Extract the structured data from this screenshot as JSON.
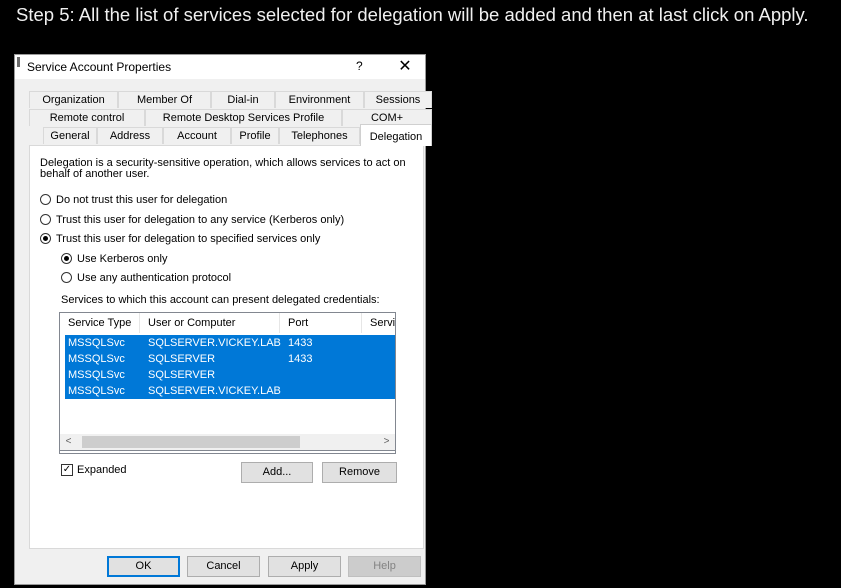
{
  "caption": "Step 5: All the list of services selected for delegation will be added and then at last click on Apply.",
  "dialog": {
    "title": "Service Account Properties",
    "help_label": "?",
    "close_label": "✕",
    "tabs_row1": [
      "Organization",
      "Member Of",
      "Dial-in",
      "Environment",
      "Sessions"
    ],
    "tabs_row2": [
      "Remote control",
      "Remote Desktop Services Profile",
      "COM+"
    ],
    "tabs_row3": [
      "General",
      "Address",
      "Account",
      "Profile",
      "Telephones",
      "Delegation"
    ],
    "active_tab": "Delegation",
    "description": "Delegation is a security-sensitive operation, which allows services to act on behalf of another user.",
    "trust_options": [
      {
        "label": "Do not trust this user for delegation",
        "selected": false
      },
      {
        "label": "Trust this user for delegation to any service (Kerberos only)",
        "selected": false
      },
      {
        "label": "Trust this user for delegation to specified services only",
        "selected": true
      }
    ],
    "protocol_options": [
      {
        "label": "Use Kerberos only",
        "selected": true
      },
      {
        "label": "Use any authentication protocol",
        "selected": false
      }
    ],
    "services_label": "Services to which this account can present delegated credentials:",
    "columns": [
      "Service Type",
      "User or Computer",
      "Port",
      "Servic"
    ],
    "rows": [
      {
        "service_type": "MSSQLSvc",
        "user_or_computer": "SQLSERVER.VICKEY.LAB",
        "port": "1433"
      },
      {
        "service_type": "MSSQLSvc",
        "user_or_computer": "SQLSERVER",
        "port": "1433"
      },
      {
        "service_type": "MSSQLSvc",
        "user_or_computer": "SQLSERVER",
        "port": ""
      },
      {
        "service_type": "MSSQLSvc",
        "user_or_computer": "SQLSERVER.VICKEY.LAB",
        "port": ""
      }
    ],
    "expanded_label": "Expanded",
    "expanded_checked": true,
    "add_label": "Add...",
    "remove_label": "Remove",
    "ok_label": "OK",
    "cancel_label": "Cancel",
    "apply_label": "Apply",
    "help_button_label": "Help",
    "scroll_left": "<",
    "scroll_right": ">",
    "check_mark": "✓"
  }
}
